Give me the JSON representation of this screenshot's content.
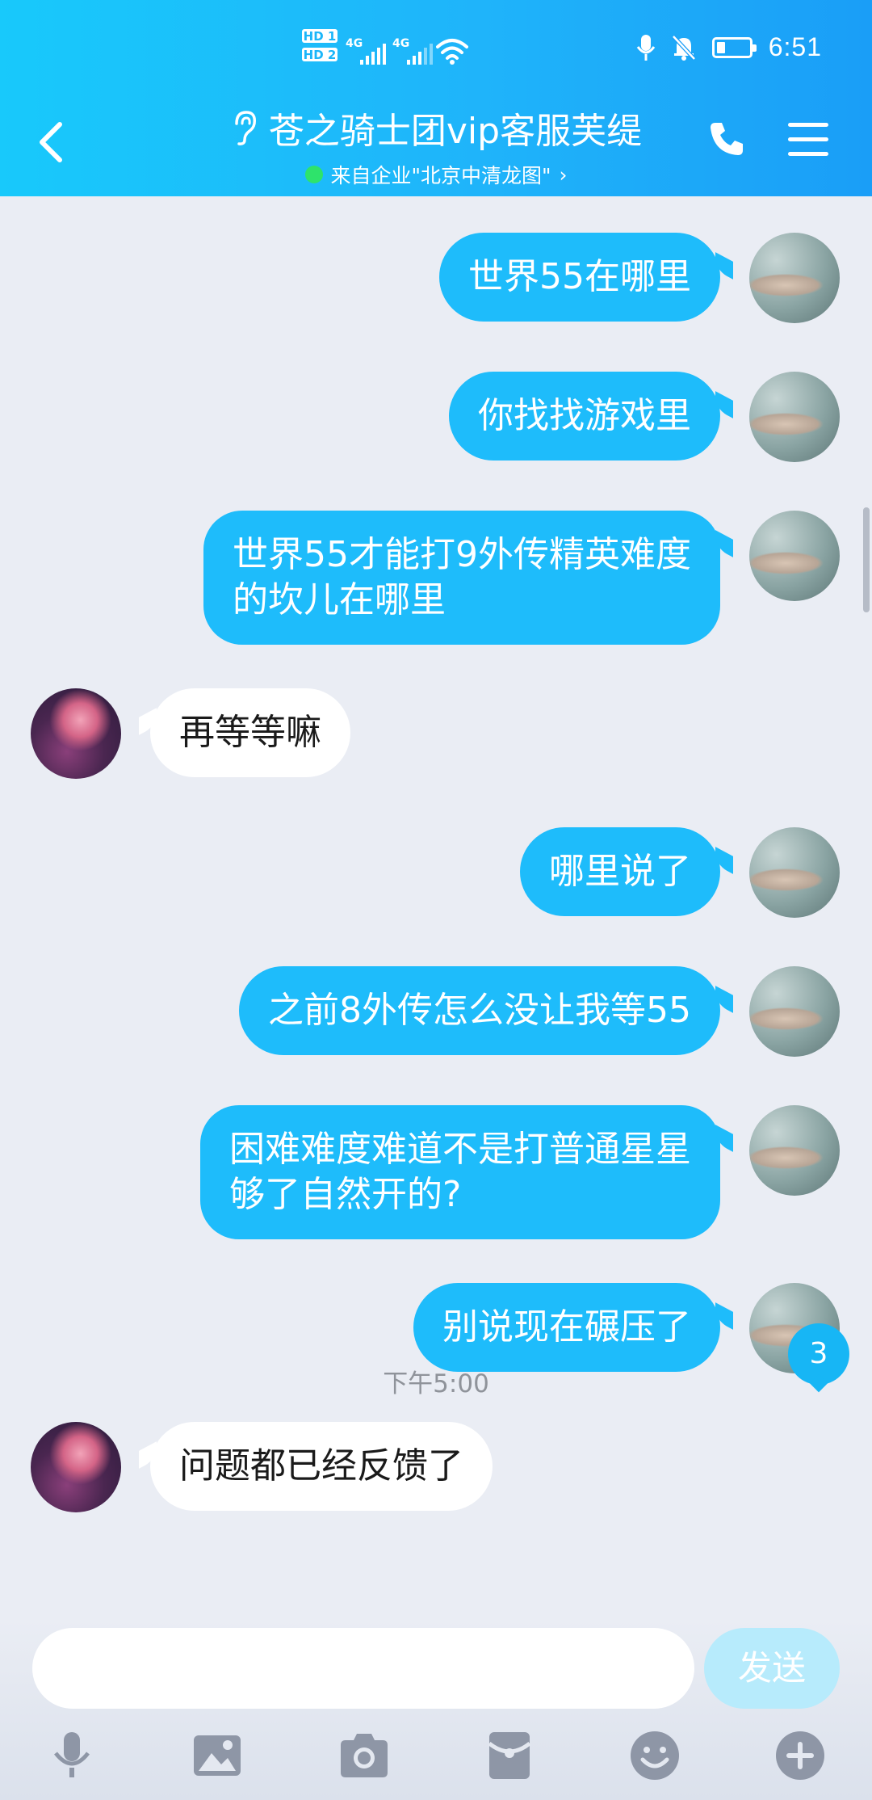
{
  "status_bar": {
    "hd1": "HD 1",
    "hd2": "HD 2",
    "net1": "4G",
    "net2": "4G",
    "time": "6:51",
    "battery_level": 0.25
  },
  "header": {
    "title": "苍之骑士团vip客服芙缇",
    "subtitle": "来自企业\"北京中清龙图\"",
    "subtitle_chevron": "›"
  },
  "messages": [
    {
      "from": "me",
      "text": "世界55在哪里"
    },
    {
      "from": "me",
      "text": "你找找游戏里"
    },
    {
      "from": "me",
      "lines": [
        "世界55才能打9外传精英难度",
        "的坎儿在哪里"
      ]
    },
    {
      "from": "cs",
      "text": "再等等嘛"
    },
    {
      "from": "me",
      "text": "哪里说了"
    },
    {
      "from": "me",
      "text": "之前8外传怎么没让我等55"
    },
    {
      "from": "me",
      "lines": [
        "困难难度难道不是打普通星星",
        "够了自然开的?"
      ]
    },
    {
      "from": "me",
      "text": "别说现在碾压了"
    },
    {
      "from": "cs",
      "text": "问题都已经反馈了"
    }
  ],
  "timestamp": "下午5:00",
  "unread_badge": "3",
  "input": {
    "placeholder": "",
    "send_label": "发送"
  },
  "toolbar_icons": [
    "microphone-icon",
    "image-icon",
    "camera-icon",
    "red-packet-icon",
    "emoji-icon",
    "plus-icon"
  ],
  "colors": {
    "header": "#1fb4fa",
    "my_bubble": "#1ebcfb",
    "their_bubble": "#ffffff",
    "background": "#eaedf4"
  }
}
